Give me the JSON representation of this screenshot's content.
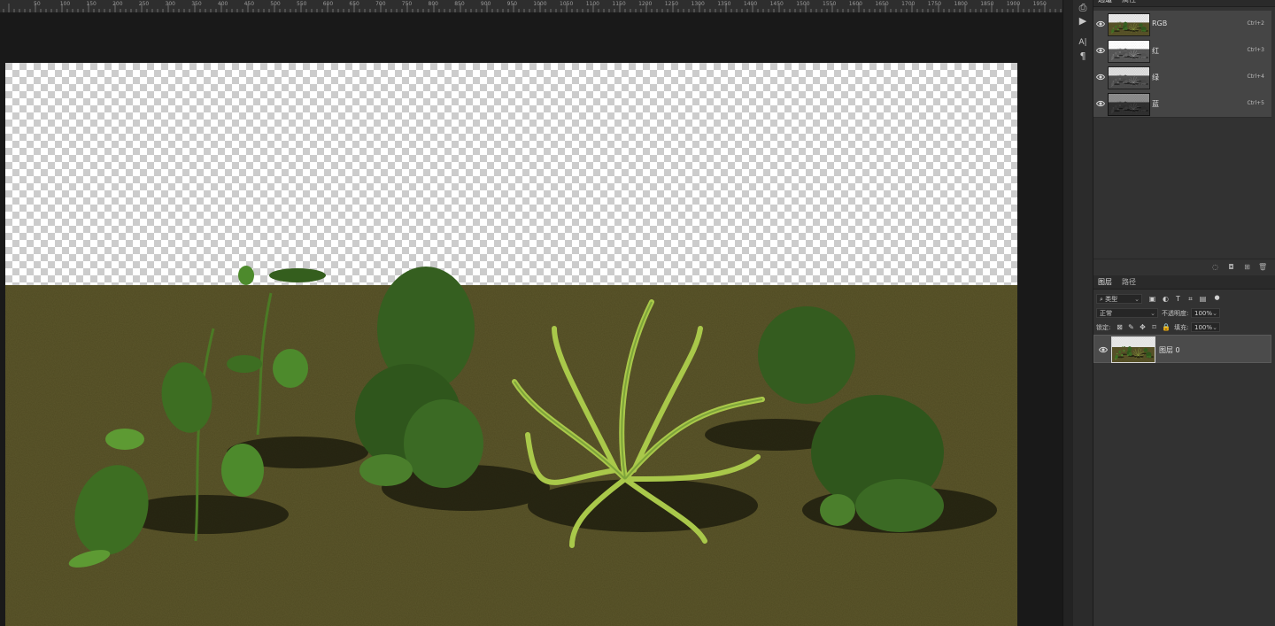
{
  "ruler": {
    "labels": [
      "50",
      "100",
      "150",
      "200",
      "250",
      "300",
      "350",
      "400",
      "450",
      "500",
      "550",
      "600",
      "650",
      "700",
      "750",
      "800",
      "850",
      "900",
      "950",
      "1000",
      "1050",
      "1100",
      "1150",
      "1200",
      "1250",
      "1300",
      "1350",
      "1400",
      "1450",
      "1500",
      "1550",
      "1600",
      "1650",
      "1700",
      "1750",
      "1800",
      "1850",
      "1900",
      "1950"
    ]
  },
  "channels_panel": {
    "tabs": [
      "通道",
      "属性"
    ],
    "channels": [
      {
        "name": "RGB",
        "shortcut": "Ctrl+2"
      },
      {
        "name": "红",
        "shortcut": "Ctrl+3"
      },
      {
        "name": "绿",
        "shortcut": "Ctrl+4"
      },
      {
        "name": "蓝",
        "shortcut": "Ctrl+5"
      }
    ]
  },
  "layers_panel": {
    "tabs": [
      "图层",
      "路径"
    ],
    "filter_kind": "类型",
    "blend_mode": "正常",
    "opacity_label": "不透明度:",
    "opacity_value": "100%",
    "lock_label": "锁定:",
    "fill_label": "填充:",
    "fill_value": "100%",
    "layers": [
      {
        "name": "图层 0"
      }
    ]
  },
  "colors": {
    "workspace": "#191919",
    "panel": "#323232",
    "ground": "#4f4a22",
    "selected_row": "#4b4b4b"
  },
  "icons": [
    "eye-icon",
    "search-icon",
    "image-filter-icon",
    "adjustment-filter-icon",
    "text-filter-icon",
    "shape-filter-icon",
    "smart-object-filter-icon",
    "lock-transparent-icon",
    "lock-paint-icon",
    "lock-move-icon",
    "lock-all-icon",
    "load-selection-icon",
    "save-selection-icon",
    "new-channel-icon",
    "delete-channel-icon",
    "history-icon",
    "play-icon",
    "character-icon",
    "paragraph-icon"
  ]
}
